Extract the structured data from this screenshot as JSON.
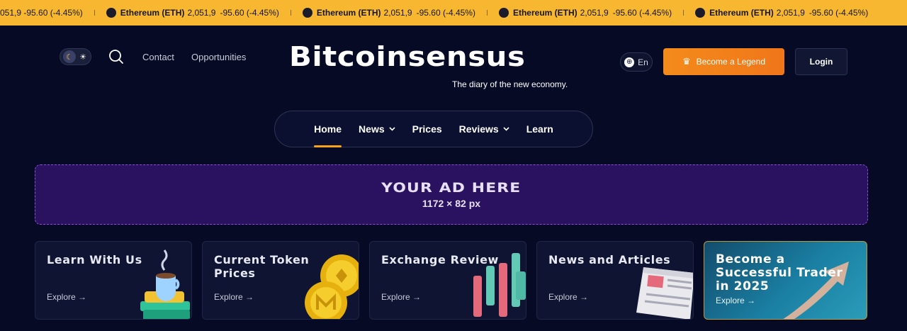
{
  "ticker": {
    "fragment": "051,9  -95.60 (-4.45%)",
    "items": [
      {
        "name": "Ethereum (ETH)",
        "price": "2,051,9",
        "change": "-95.60 (-4.45%)"
      },
      {
        "name": "Ethereum (ETH)",
        "price": "2,051,9",
        "change": "-95.60 (-4.45%)"
      },
      {
        "name": "Ethereum (ETH)",
        "price": "2,051,9",
        "change": "-95.60 (-4.45%)"
      },
      {
        "name": "Ethereum (ETH)",
        "price": "2,051,9",
        "change": "-95.60 (-4.45%)"
      }
    ]
  },
  "header": {
    "links": [
      "Contact",
      "Opportunities"
    ],
    "logo": "Bitcoinsensus",
    "tagline": "The diary of the new economy.",
    "language": "En",
    "legend_button": "Become a Legend",
    "login_button": "Login"
  },
  "nav": {
    "items": [
      {
        "label": "Home",
        "active": true,
        "dropdown": false
      },
      {
        "label": "News",
        "active": false,
        "dropdown": true
      },
      {
        "label": "Prices",
        "active": false,
        "dropdown": false
      },
      {
        "label": "Reviews",
        "active": false,
        "dropdown": true
      },
      {
        "label": "Learn",
        "active": false,
        "dropdown": false
      }
    ]
  },
  "ad": {
    "title": "YOUR AD HERE",
    "size": "1172 × 82 px"
  },
  "cards": [
    {
      "title": "Learn With Us",
      "explore": "Explore →"
    },
    {
      "title": "Current Token Prices",
      "explore": "Explore →"
    },
    {
      "title": "Exchange Review",
      "explore": "Explore →"
    },
    {
      "title": "News and Articles",
      "explore": "Explore →"
    },
    {
      "title": "Become a Successful Trader in 2025",
      "explore": "Explore →"
    }
  ],
  "colors": {
    "ticker_bg": "#f7b731",
    "page_bg": "#060a24",
    "accent_orange": "#f48b1b",
    "ad_bg": "#2b1260"
  }
}
